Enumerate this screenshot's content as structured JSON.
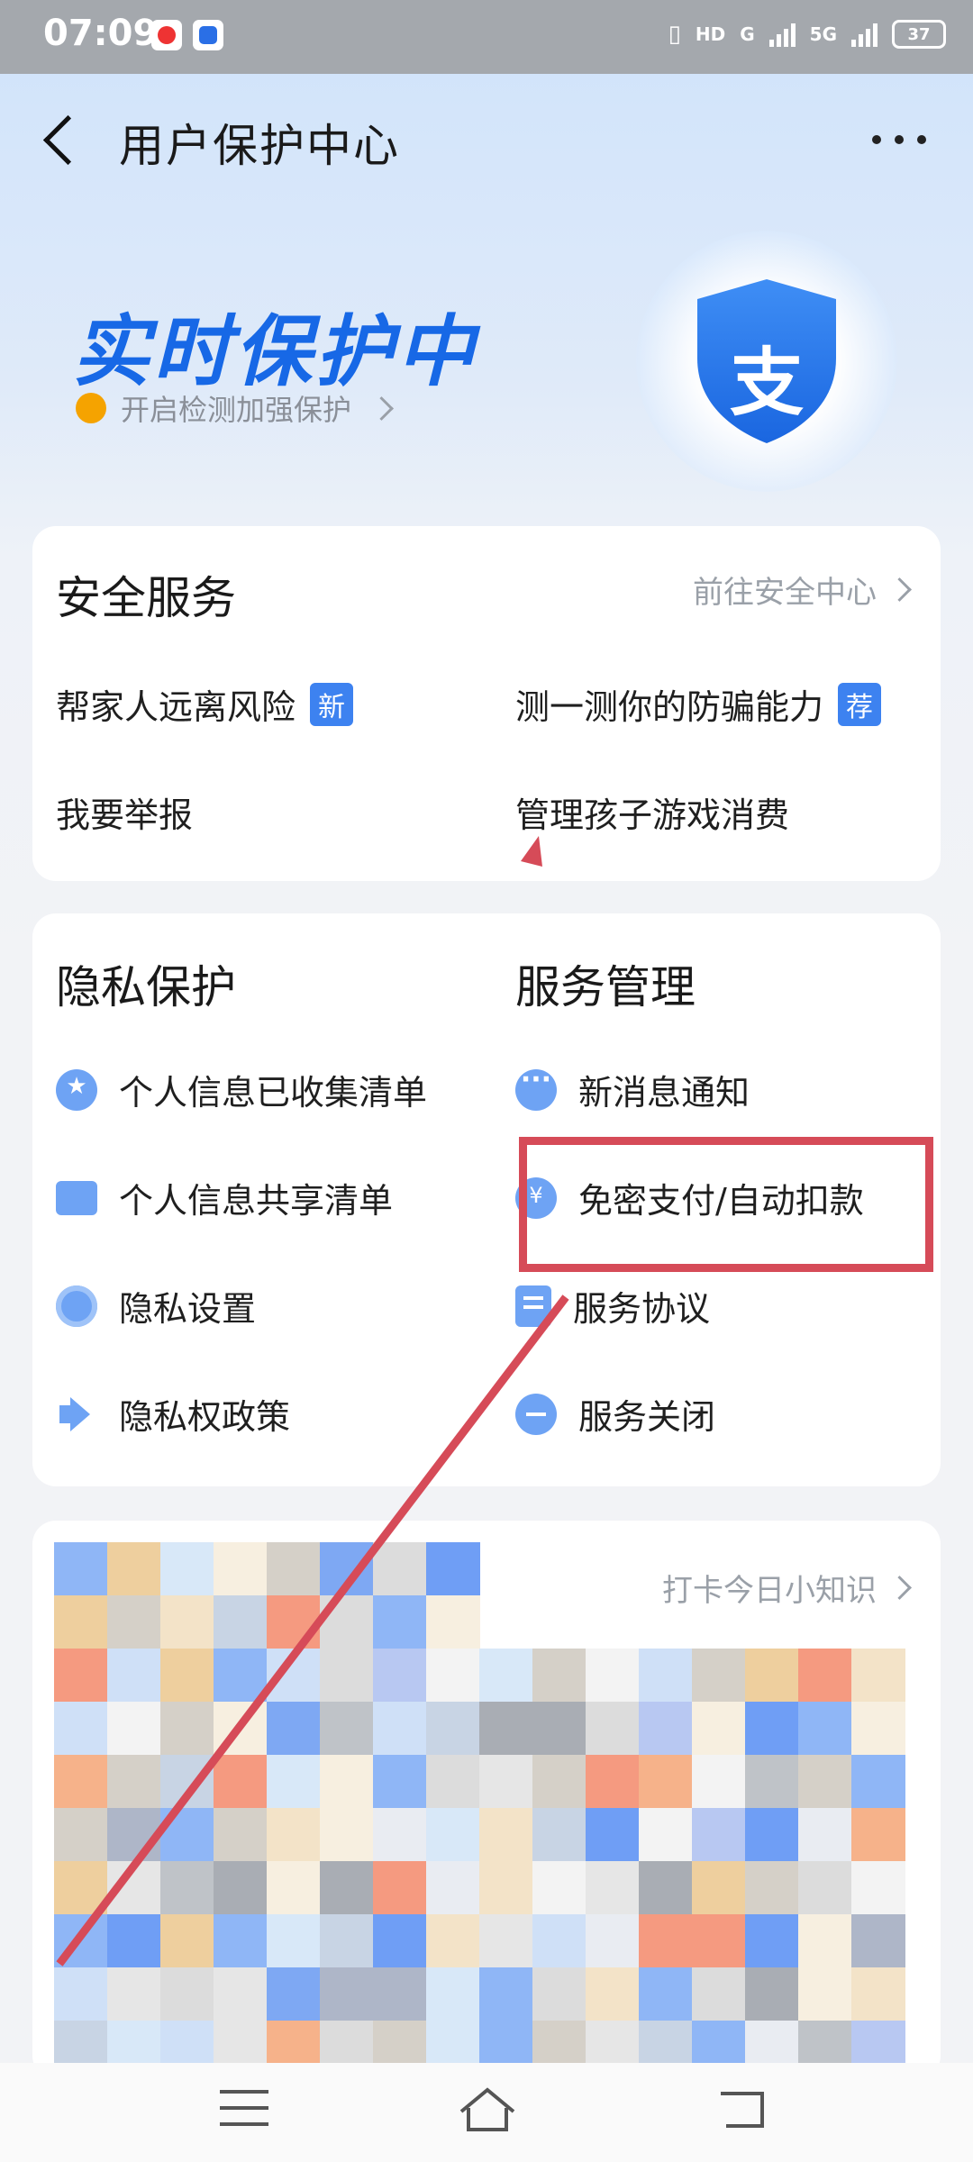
{
  "status_bar": {
    "time": "07:09",
    "network_hd": "HD",
    "network_g": "G",
    "network_5g": "5G",
    "battery": "37"
  },
  "header": {
    "title": "用户保护中心"
  },
  "hero": {
    "title": "实时保护中",
    "subtitle": "开启检测加强保护",
    "shield_char": "支"
  },
  "security_card": {
    "title": "安全服务",
    "link": "前往安全中心",
    "items": [
      {
        "label": "帮家人远离风险",
        "badge": "新"
      },
      {
        "label": "测一测你的防骗能力",
        "badge": "荐"
      },
      {
        "label": "我要举报"
      },
      {
        "label": "管理孩子游戏消费"
      }
    ]
  },
  "privacy_card": {
    "privacy_title": "隐私保护",
    "service_title": "服务管理",
    "privacy_items": [
      {
        "label": "个人信息已收集清单",
        "icon": "star-icon"
      },
      {
        "label": "个人信息共享清单",
        "icon": "folder-icon"
      },
      {
        "label": "隐私设置",
        "icon": "gear-icon"
      },
      {
        "label": "隐私权政策",
        "icon": "speaker-icon"
      }
    ],
    "service_items": [
      {
        "label": "新消息通知",
        "icon": "chat-icon"
      },
      {
        "label": "免密支付/自动扣款",
        "icon": "yen-icon"
      },
      {
        "label": "服务协议",
        "icon": "document-icon"
      },
      {
        "label": "服务关闭",
        "icon": "minus-icon"
      }
    ]
  },
  "knowledge_card": {
    "link": "打卡今日小知识"
  },
  "colors": {
    "accent": "#1768e6",
    "badge": "#3d82f0",
    "annotation": "#d64b58",
    "orange": "#f5a300"
  }
}
